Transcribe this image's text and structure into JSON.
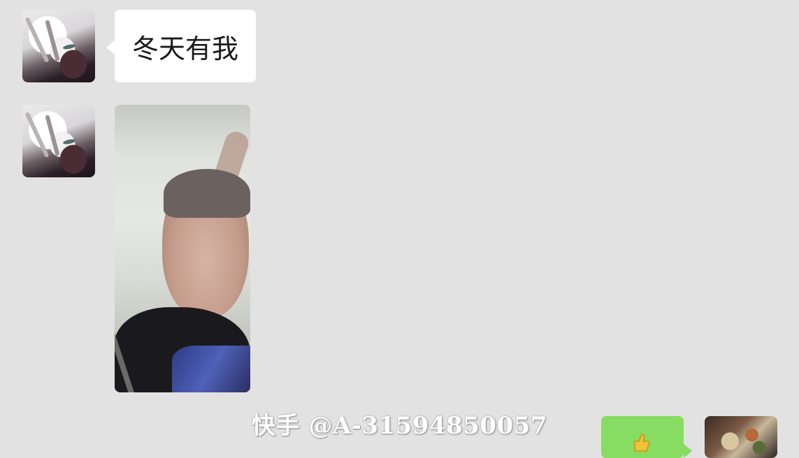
{
  "messages": [
    {
      "side": "left",
      "type": "text",
      "text": "冬天有我"
    },
    {
      "side": "left",
      "type": "image"
    },
    {
      "side": "right",
      "type": "emoji",
      "emoji_icon": "thumbs-up-icon"
    }
  ],
  "watermark": "快手 @A-31594850057",
  "colors": {
    "background": "#e2e2e2",
    "incoming_bubble": "#ffffff",
    "outgoing_bubble": "#86dd61"
  }
}
